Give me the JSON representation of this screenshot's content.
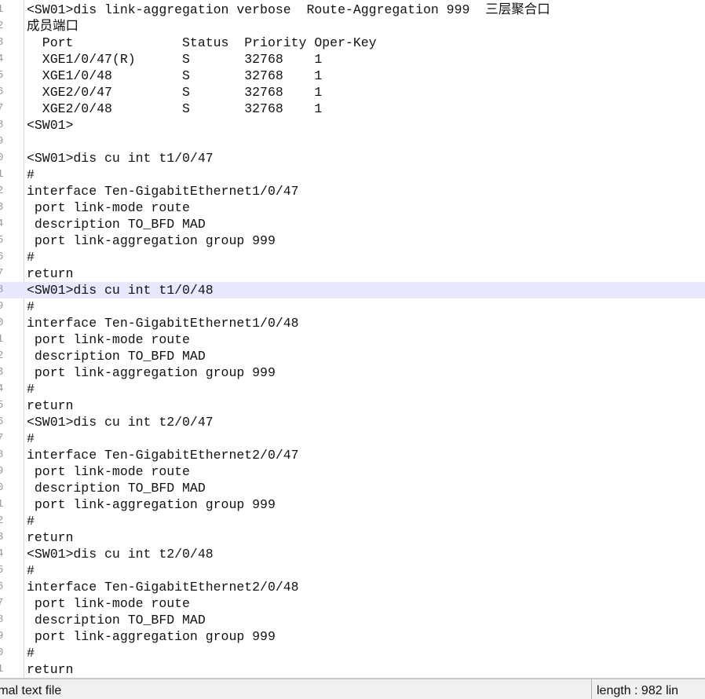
{
  "editor": {
    "current_line": 18,
    "lines": [
      {
        "n": "1",
        "text": "<SW01>dis link-aggregation verbose  Route-Aggregation 999  三层聚合口"
      },
      {
        "n": "2",
        "text": "成员端口"
      },
      {
        "n": "3",
        "text": "  Port              Status  Priority Oper-Key"
      },
      {
        "n": "4",
        "text": "  XGE1/0/47(R)      S       32768    1"
      },
      {
        "n": "5",
        "text": "  XGE1/0/48         S       32768    1"
      },
      {
        "n": "6",
        "text": "  XGE2/0/47         S       32768    1"
      },
      {
        "n": "7",
        "text": "  XGE2/0/48         S       32768    1"
      },
      {
        "n": "8",
        "text": "<SW01>"
      },
      {
        "n": "9",
        "text": ""
      },
      {
        "n": "0",
        "text": "<SW01>dis cu int t1/0/47"
      },
      {
        "n": "1",
        "text": "#"
      },
      {
        "n": "2",
        "text": "interface Ten-GigabitEthernet1/0/47"
      },
      {
        "n": "3",
        "text": " port link-mode route"
      },
      {
        "n": "4",
        "text": " description TO_BFD MAD"
      },
      {
        "n": "5",
        "text": " port link-aggregation group 999"
      },
      {
        "n": "6",
        "text": "#"
      },
      {
        "n": "7",
        "text": "return"
      },
      {
        "n": "8",
        "text": "<SW01>dis cu int t1/0/48"
      },
      {
        "n": "9",
        "text": "#"
      },
      {
        "n": "0",
        "text": "interface Ten-GigabitEthernet1/0/48"
      },
      {
        "n": "1",
        "text": " port link-mode route"
      },
      {
        "n": "2",
        "text": " description TO_BFD MAD"
      },
      {
        "n": "3",
        "text": " port link-aggregation group 999"
      },
      {
        "n": "4",
        "text": "#"
      },
      {
        "n": "5",
        "text": "return"
      },
      {
        "n": "6",
        "text": "<SW01>dis cu int t2/0/47"
      },
      {
        "n": "7",
        "text": "#"
      },
      {
        "n": "8",
        "text": "interface Ten-GigabitEthernet2/0/47"
      },
      {
        "n": "9",
        "text": " port link-mode route"
      },
      {
        "n": "0",
        "text": " description TO_BFD MAD"
      },
      {
        "n": "1",
        "text": " port link-aggregation group 999"
      },
      {
        "n": "2",
        "text": "#"
      },
      {
        "n": "3",
        "text": "return"
      },
      {
        "n": "4",
        "text": "<SW01>dis cu int t2/0/48"
      },
      {
        "n": "5",
        "text": "#"
      },
      {
        "n": "6",
        "text": "interface Ten-GigabitEthernet2/0/48"
      },
      {
        "n": "7",
        "text": " port link-mode route"
      },
      {
        "n": "8",
        "text": " description TO_BFD MAD"
      },
      {
        "n": "9",
        "text": " port link-aggregation group 999"
      },
      {
        "n": "0",
        "text": "#"
      },
      {
        "n": "1",
        "text": "return"
      }
    ]
  },
  "statusbar": {
    "file_type": "rmal text file",
    "length": "length : 982    lin"
  },
  "colors": {
    "current_line_bg": "#e8e8ff",
    "line_number": "#9a9a9a",
    "text": "#111111"
  }
}
